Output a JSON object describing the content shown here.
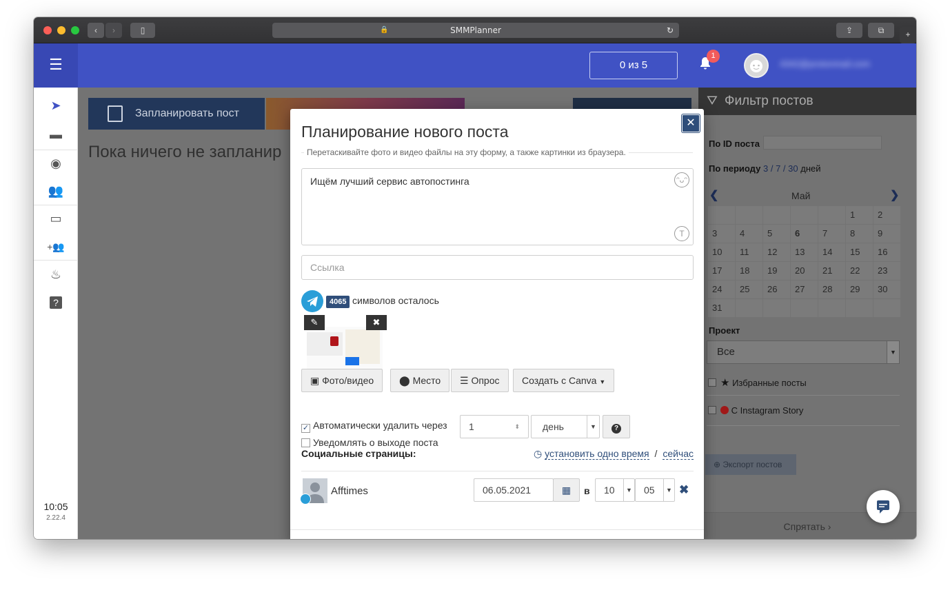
{
  "browser": {
    "url": "SMMPlanner"
  },
  "header": {
    "counter": "0 из 5",
    "notifications": "1",
    "email": "4342@protonmail.com"
  },
  "sidebar": {
    "time": "10:05",
    "version": "2.22.4"
  },
  "main": {
    "plan_button": "Запланировать пост",
    "empty_text": "Пока ничего не запланир"
  },
  "filter": {
    "title": "Фильтр постов",
    "post_id_label": "По ID поста",
    "period_label": "По периоду",
    "period_3": "3",
    "period_7": "7",
    "period_30": "30",
    "period_unit": "дней",
    "sep": "/",
    "month": "Май",
    "days": [
      [
        "",
        "",
        "",
        "",
        "",
        "1",
        "2"
      ],
      [
        "3",
        "4",
        "5",
        "6",
        "7",
        "8",
        "9"
      ],
      [
        "10",
        "11",
        "12",
        "13",
        "14",
        "15",
        "16"
      ],
      [
        "17",
        "18",
        "19",
        "20",
        "21",
        "22",
        "23"
      ],
      [
        "24",
        "25",
        "26",
        "27",
        "28",
        "29",
        "30"
      ],
      [
        "31",
        "",
        "",
        "",
        "",
        "",
        ""
      ]
    ],
    "project_label": "Проект",
    "project_value": "Все",
    "favorites": "Избранные посты",
    "instagram_story": "С Instagram Story",
    "export": "Экспорт постов",
    "hide": "Спрятать"
  },
  "modal": {
    "title": "Планирование нового поста",
    "hint": "Перетаскивайте фото и видео файлы на эту форму, а также картинки из браузера.",
    "text": "Ищём лучший сервис автопостинга",
    "link_placeholder": "Ссылка",
    "chars_count": "4065",
    "chars_text": "символов осталось",
    "btn_photo": "Фото/видео",
    "btn_place": "Место",
    "btn_poll": "Опрос",
    "btn_canva": "Создать с Canva",
    "auto_delete_label": "Автоматически удалить через",
    "auto_delete_value": "1",
    "auto_delete_unit": "день",
    "notify_label": "Уведомлять о выходе поста",
    "social_label": "Социальные страницы:",
    "set_time": "установить одно время",
    "slash": "/",
    "now": "сейчас",
    "account_name": "Afftimes",
    "date": "06.05.2021",
    "at": "в",
    "hour": "10",
    "minute": "05"
  },
  "colors": {
    "brand": "#4052c4",
    "accent": "#2f4e7a",
    "telegram": "#2a9ed8"
  }
}
